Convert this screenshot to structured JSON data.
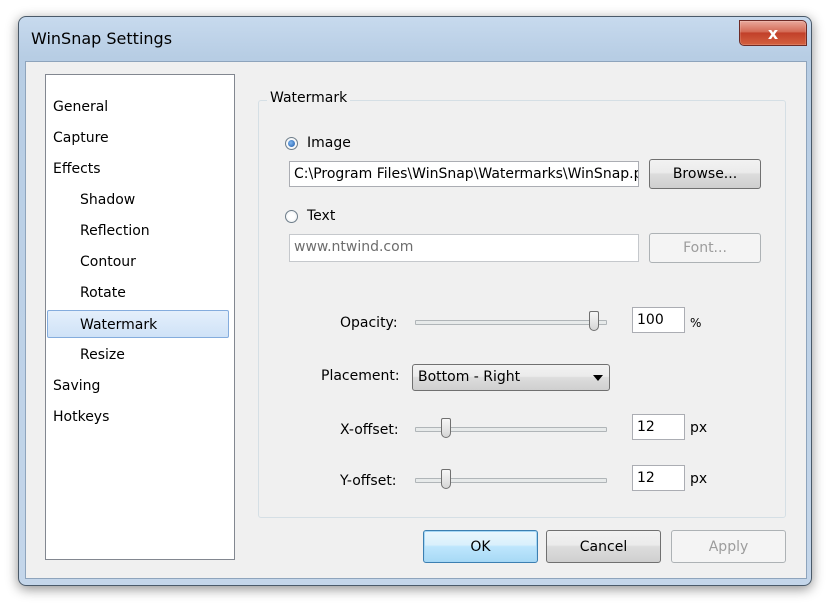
{
  "window": {
    "title": "WinSnap Settings",
    "close_glyph": "x"
  },
  "sidebar": {
    "items": [
      {
        "label": "General"
      },
      {
        "label": "Capture"
      },
      {
        "label": "Effects"
      },
      {
        "label": "Shadow"
      },
      {
        "label": "Reflection"
      },
      {
        "label": "Contour"
      },
      {
        "label": "Rotate"
      },
      {
        "label": "Watermark"
      },
      {
        "label": "Resize"
      },
      {
        "label": "Saving"
      },
      {
        "label": "Hotkeys"
      }
    ],
    "selected": "Watermark"
  },
  "watermark": {
    "group_title": "Watermark",
    "image_option": {
      "label": "Image",
      "selected": true
    },
    "image_path": "C:\\Program Files\\WinSnap\\Watermarks\\WinSnap.png",
    "browse_label": "Browse...",
    "text_option": {
      "label": "Text",
      "selected": false
    },
    "text_value": "www.ntwind.com",
    "font_label": "Font...",
    "opacity": {
      "label": "Opacity:",
      "value": "100",
      "unit": "%",
      "level": 1.0
    },
    "placement": {
      "label": "Placement:",
      "value": "Bottom - Right"
    },
    "x_offset": {
      "label": "X-offset:",
      "value": "12",
      "unit": "px",
      "level": 0.12
    },
    "y_offset": {
      "label": "Y-offset:",
      "value": "12",
      "unit": "px",
      "level": 0.12
    }
  },
  "footer": {
    "ok_label": "OK",
    "cancel_label": "Cancel",
    "apply_label": "Apply"
  }
}
